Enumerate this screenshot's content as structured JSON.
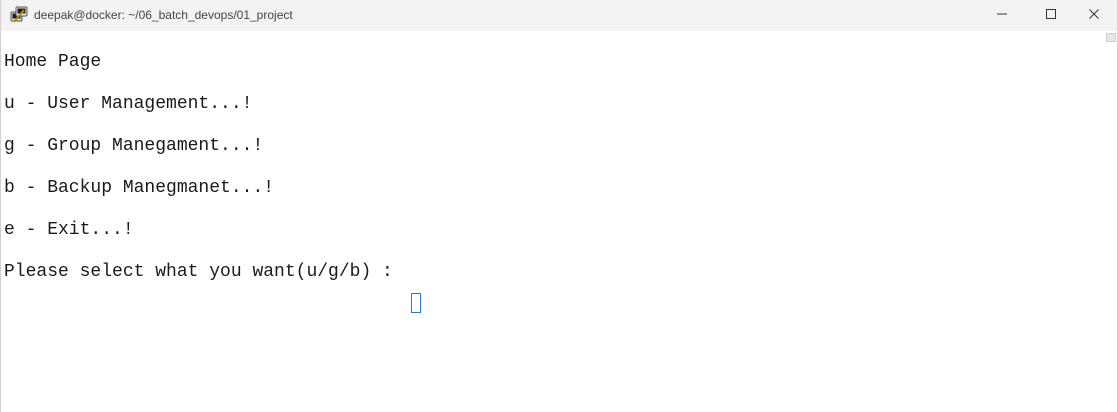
{
  "window": {
    "title": "deepak@docker: ~/06_batch_devops/01_project",
    "app_icon": "putty-terminal-icon",
    "controls": {
      "minimize_icon": "minimize-icon",
      "maximize_icon": "maximize-icon",
      "close_icon": "close-icon"
    }
  },
  "terminal": {
    "lines": [
      "Home Page",
      "u - User Management...!",
      "g - Group Manegament...!",
      "b - Backup Manegmanet...!",
      "e - Exit...!",
      "Please select what you want(u/g/b) : "
    ],
    "cursor_color": "#2b7bd0",
    "text_color": "#1a1a1a",
    "background": "#ffffff"
  }
}
